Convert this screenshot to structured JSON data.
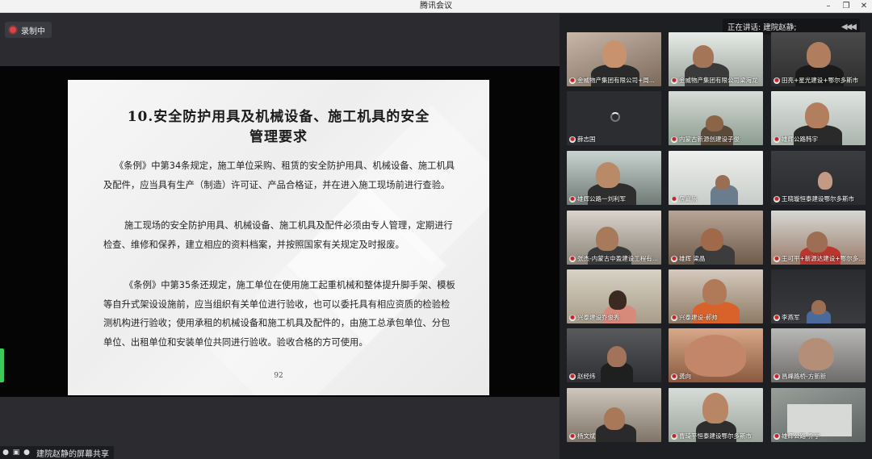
{
  "window": {
    "title": "腾讯会议"
  },
  "recording": {
    "label": "录制中"
  },
  "speaking": {
    "label": "正在讲话: 建院赵静;"
  },
  "slide": {
    "title_line1": "10.安全防护用具及机械设备、施工机具的安全",
    "title_line2": "管理要求",
    "paragraphs": [
      "《条例》中第34条规定，施工单位采购、租赁的安全防护用具、机械设备、施工机具及配件，应当具有生产（制造）许可证、产品合格证，并在进入施工现场前进行查验。",
      "施工现场的安全防护用具、机械设备、施工机具及配件必须由专人管理，定期进行检查、维修和保养，建立相应的资料档案，并按照国家有关规定及时报废。",
      "《条例》中第35条还规定，施工单位在使用施工起重机械和整体提升脚手架、模板等自升式架设设施前，应当组织有关单位进行验收，也可以委托具有相应资质的检验检测机构进行验收；使用承租的机械设备和施工机具及配件的，由施工总承包单位、分包单位、出租单位和安装单位共同进行验收。验收合格的方可使用。"
    ],
    "page": "92"
  },
  "share": {
    "label": "建院赵静的屏幕共享"
  },
  "participants": [
    {
      "name": "金威物产集团有限公司+周..."
    },
    {
      "name": "金威物产集团有限公司梁海龙"
    },
    {
      "name": "田亮+星光建设+鄂尔多斯市"
    },
    {
      "name": "薛志国"
    },
    {
      "name": "内蒙古新源创建设子俊"
    },
    {
      "name": "雄辉公路韩宇"
    },
    {
      "name": "雄辉公路一刘利军"
    },
    {
      "name": "房嘉乐"
    },
    {
      "name": "王晓璇恒泰建设鄂尔多斯市"
    },
    {
      "name": "张杰-内蒙古中盈建设工程有..."
    },
    {
      "name": "雄辉 梁晶"
    },
    {
      "name": "王可平+新源达建设+鄂尔多..."
    },
    {
      "name": "兴泰建设乔俊秀"
    },
    {
      "name": "兴泰建设-郝帅"
    },
    {
      "name": "李燕军"
    },
    {
      "name": "赵经纬"
    },
    {
      "name": "龚向"
    },
    {
      "name": "昌峰路桥-方新新"
    },
    {
      "name": "杨文斌"
    },
    {
      "name": "曹琦平恒泰建设鄂尔多斯市"
    },
    {
      "name": "雄辉公路-乔宁"
    }
  ]
}
